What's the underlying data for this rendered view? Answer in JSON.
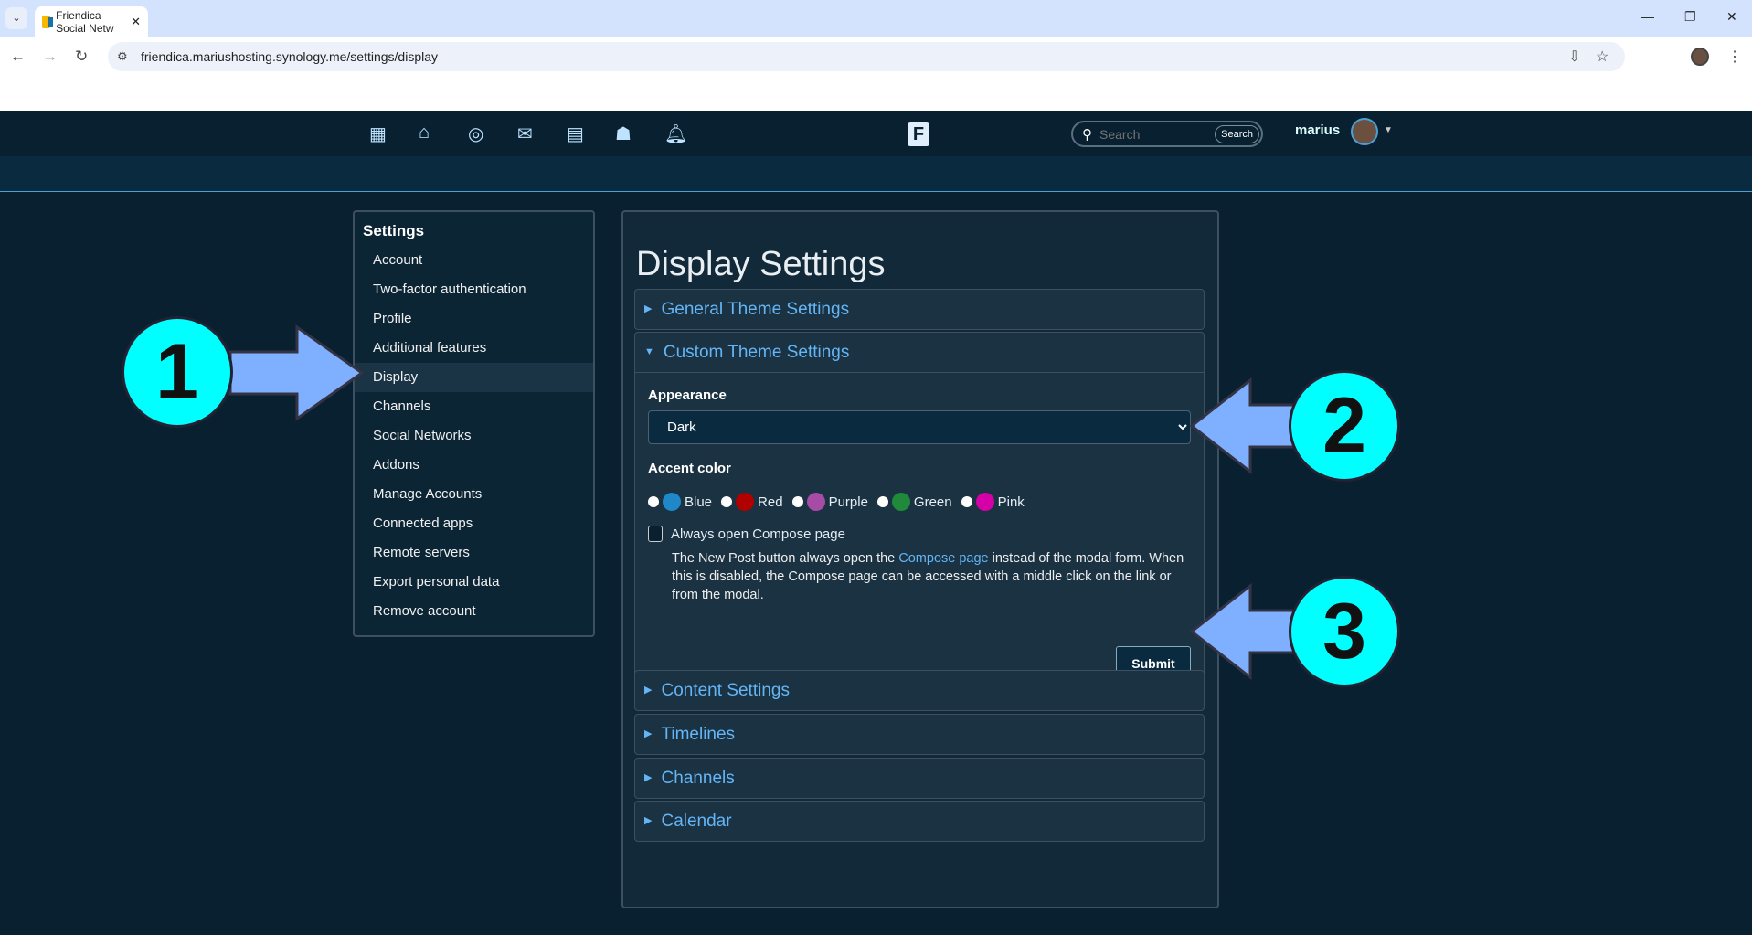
{
  "browser": {
    "tab_title": "Friendica Social Netw",
    "url": "friendica.mariushosting.synology.me/settings/display"
  },
  "navbar": {
    "icons": [
      "apps-grid-icon",
      "home-icon",
      "network-icon",
      "mail-icon",
      "calendar-icon",
      "groups-icon",
      "bell-icon"
    ],
    "search_placeholder": "Search",
    "search_button": "Search",
    "username": "marius"
  },
  "sidebar": {
    "title": "Settings",
    "items": [
      {
        "label": "Account"
      },
      {
        "label": "Two-factor authentication"
      },
      {
        "label": "Profile"
      },
      {
        "label": "Additional features"
      },
      {
        "label": "Display",
        "active": true
      },
      {
        "label": "Channels"
      },
      {
        "label": "Social Networks"
      },
      {
        "label": "Addons"
      },
      {
        "label": "Manage Accounts"
      },
      {
        "label": "Connected apps"
      },
      {
        "label": "Remote servers"
      },
      {
        "label": "Export personal data"
      },
      {
        "label": "Remove account"
      }
    ]
  },
  "main": {
    "title": "Display Settings",
    "sections": [
      {
        "label": "General Theme Settings"
      },
      {
        "label": "Custom Theme Settings",
        "expanded": true
      },
      {
        "label": "Content Settings"
      },
      {
        "label": "Timelines"
      },
      {
        "label": "Channels"
      },
      {
        "label": "Calendar"
      }
    ],
    "appearance_label": "Appearance",
    "appearance_value": "Dark",
    "accent_label": "Accent color",
    "accents": [
      {
        "label": "Blue",
        "color": "#1e88c8"
      },
      {
        "label": "Red",
        "color": "#b00000"
      },
      {
        "label": "Purple",
        "color": "#a64ca6"
      },
      {
        "label": "Green",
        "color": "#1f8b3a"
      },
      {
        "label": "Pink",
        "color": "#d600a8"
      }
    ],
    "compose_label": "Always open Compose page",
    "help_pre": "The New Post button always open the ",
    "help_link": "Compose page",
    "help_post": " instead of the modal form. When this is disabled, the Compose page can be accessed with a middle click on the link or from the modal.",
    "submit": "Submit"
  },
  "annotations": [
    "1",
    "2",
    "3"
  ]
}
